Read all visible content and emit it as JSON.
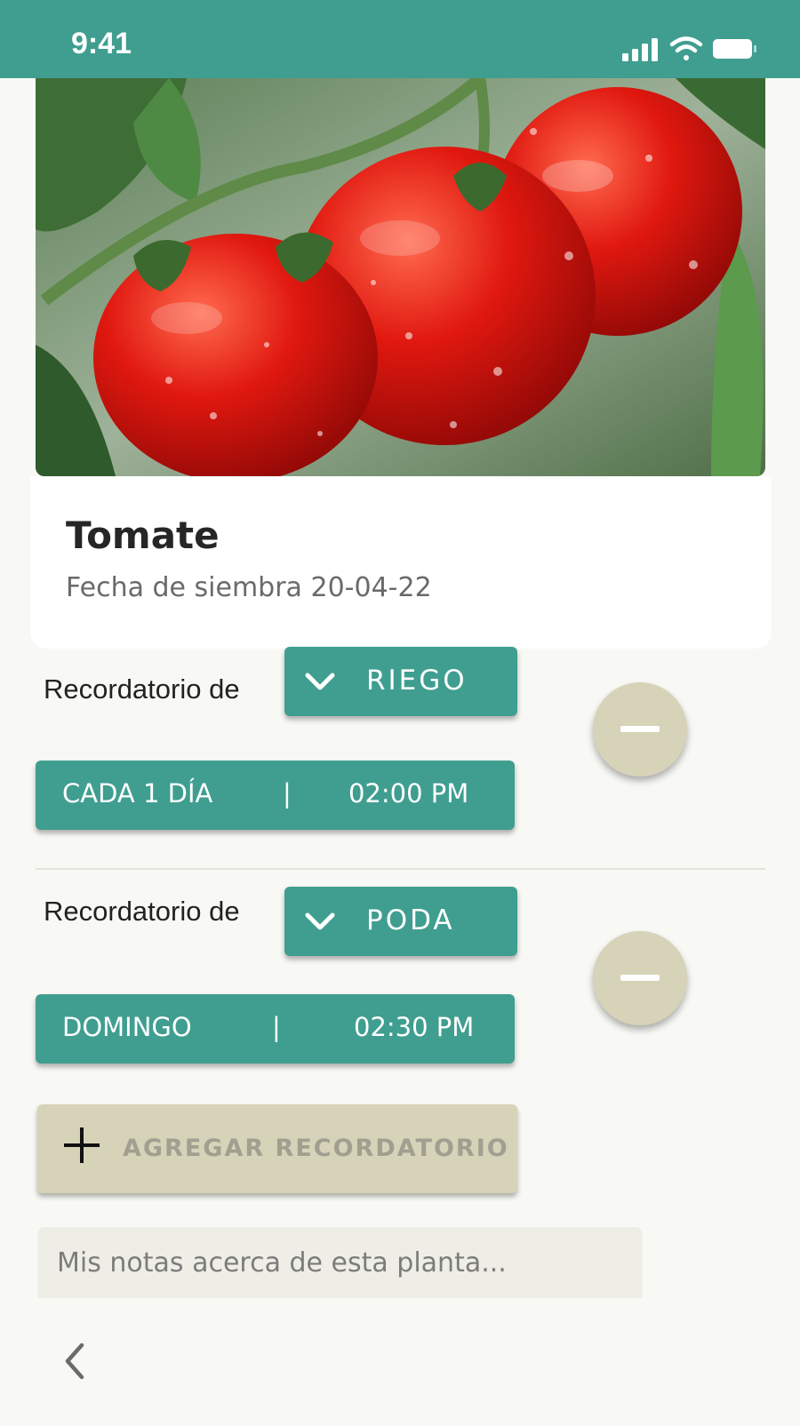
{
  "status_bar": {
    "time": "9:41",
    "background": "#3f9e8f"
  },
  "plant": {
    "name": "Tomate",
    "sow_date": "Fecha de siembra 20-04-22"
  },
  "reminders": [
    {
      "label": "Recordatorio de",
      "type": "RIEGO",
      "frequency": "CADA 1 DÍA",
      "separator": "|",
      "time": "02:00  PM"
    },
    {
      "label": "Recordatorio de",
      "type": "PODA",
      "frequency": "DOMINGO",
      "separator": "|",
      "time": "02:30  PM"
    }
  ],
  "add_button": {
    "label": "AGREGAR RECORDATORIO"
  },
  "notes": {
    "placeholder": "Mis notas acerca de esta planta..."
  },
  "colors": {
    "accent": "#3f9e8f",
    "secondary": "#d6d3b8",
    "background": "#f8f8f5"
  },
  "icons": [
    "signal-icon",
    "wifi-icon",
    "battery-icon",
    "chevron-down-icon",
    "minus-icon",
    "plus-icon",
    "back-arrow-icon"
  ]
}
